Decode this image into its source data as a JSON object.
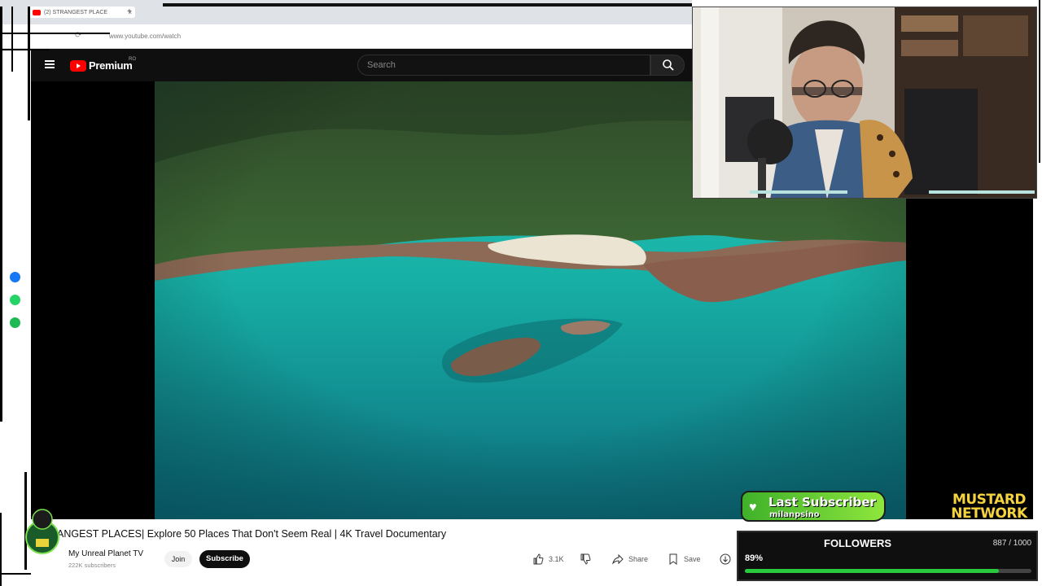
{
  "browser": {
    "tab_title": "(2) STRANGEST PLACE",
    "tab_close": "×",
    "new_tab": "+",
    "url": "www.youtube.com/watch"
  },
  "youtube": {
    "logo_text": "Premium",
    "country_code": "RO",
    "search_placeholder": "Search"
  },
  "video": {
    "title": "ANGEST PLACES| Explore 50 Places That Don't Seem Real | 4K Travel Documentary",
    "channel": "My Unreal Planet TV",
    "subscribers": "222K subscribers",
    "join_label": "Join",
    "subscribe_label": "Subscribe",
    "likes": "3.1K",
    "share_label": "Share",
    "save_label": "Save"
  },
  "overlay": {
    "last_subscriber_title": "Last Subscriber",
    "last_subscriber_name": "milanpsino",
    "brand_line1": "MUSTARD",
    "brand_line2": "NETWORK",
    "followers_label": "FOLLOWERS",
    "followers_count": "887 / 1000",
    "followers_percent": "89%",
    "followers_progress": 0.887
  },
  "colors": {
    "youtube_red": "#ff0000",
    "progress_green": "#28c93c",
    "subscriber_green": "#5cc830",
    "brand_yellow": "#f4d33f"
  }
}
